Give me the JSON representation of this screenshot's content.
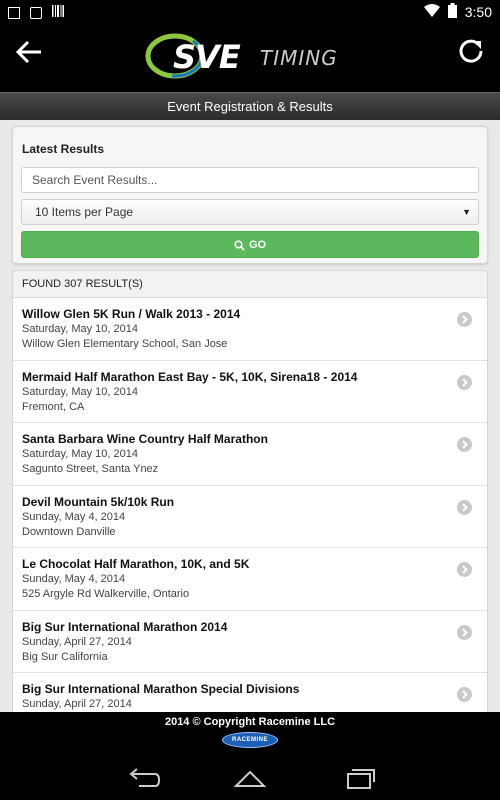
{
  "status_bar": {
    "time": "3:50"
  },
  "header": {
    "logo_main": "SVE",
    "logo_sub": "TIMING"
  },
  "subheader": {
    "title": "Event Registration & Results"
  },
  "search": {
    "title": "Latest Results",
    "placeholder": "Search Event Results...",
    "per_page": "10 Items per Page",
    "go_label": "GO"
  },
  "results": {
    "count_label": "FOUND 307 RESULT(S)",
    "items": [
      {
        "title": "Willow Glen 5K Run / Walk 2013 - 2014",
        "date": "Saturday, May 10, 2014",
        "location": "Willow Glen Elementary School, San Jose"
      },
      {
        "title": "Mermaid Half Marathon East Bay - 5K, 10K, Sirena18 - 2014",
        "date": "Saturday, May 10, 2014",
        "location": "Fremont, CA"
      },
      {
        "title": "Santa Barbara Wine Country Half Marathon",
        "date": "Saturday, May 10, 2014",
        "location": "Sagunto Street, Santa Ynez"
      },
      {
        "title": "Devil Mountain 5k/10k Run",
        "date": "Sunday, May 4, 2014",
        "location": "Downtown Danville"
      },
      {
        "title": "Le Chocolat Half Marathon, 10K, and 5K",
        "date": "Sunday, May 4, 2014",
        "location": "525 Argyle Rd Walkerville, Ontario"
      },
      {
        "title": "Big Sur International Marathon 2014",
        "date": "Sunday, April 27, 2014",
        "location": "Big Sur California"
      },
      {
        "title": "Big Sur International Marathon Special Divisions",
        "date": "Sunday, April 27, 2014",
        "location": ""
      }
    ]
  },
  "footer": {
    "copyright": "2014 © Copyright Racemine LLC",
    "logo_text": "RACEMINE"
  },
  "colors": {
    "accent_green": "#5cb85c",
    "header_bg": "#000000"
  },
  "icons": {
    "back": "arrow-left-icon",
    "refresh": "refresh-icon",
    "search": "search-icon",
    "chevron": "chevron-right-icon"
  }
}
